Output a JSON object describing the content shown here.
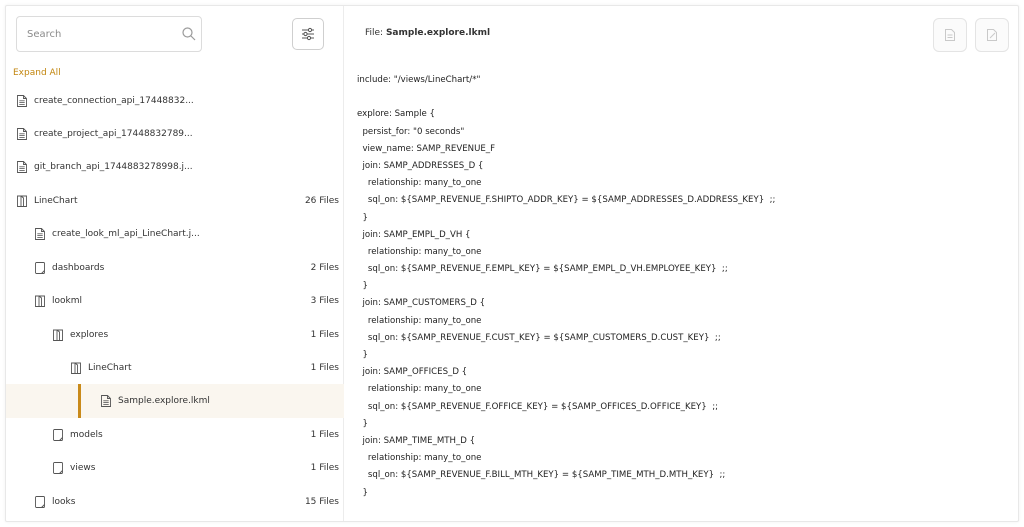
{
  "sidebar": {
    "search_placeholder": "Search",
    "expand_all": "Expand All",
    "items": [
      {
        "label": "create_connection_api_17448832...",
        "count": "",
        "type": "file",
        "depth": 0
      },
      {
        "label": "create_project_api_17448832789...",
        "count": "",
        "type": "file",
        "depth": 0
      },
      {
        "label": "git_branch_api_1744883278998.j...",
        "count": "",
        "type": "file",
        "depth": 0
      },
      {
        "label": "LineChart",
        "count": "26 Files",
        "type": "folder",
        "depth": 0
      },
      {
        "label": "create_look_ml_api_LineChart.j...",
        "count": "",
        "type": "file",
        "depth": 1
      },
      {
        "label": "dashboards",
        "count": "2 Files",
        "type": "folder-empty",
        "depth": 1
      },
      {
        "label": "lookml",
        "count": "3 Files",
        "type": "folder",
        "depth": 1
      },
      {
        "label": "explores",
        "count": "1 Files",
        "type": "folder",
        "depth": 2
      },
      {
        "label": "LineChart",
        "count": "1 Files",
        "type": "folder",
        "depth": 3
      },
      {
        "label": "Sample.explore.lkml",
        "count": "",
        "type": "file",
        "depth": 4,
        "selected": true
      },
      {
        "label": "models",
        "count": "1 Files",
        "type": "folder-empty",
        "depth": 2
      },
      {
        "label": "views",
        "count": "1 Files",
        "type": "folder-empty",
        "depth": 2
      },
      {
        "label": "looks",
        "count": "15 Files",
        "type": "folder-empty",
        "depth": 1
      }
    ]
  },
  "header": {
    "file_prefix": "File: ",
    "file_name": "Sample.explore.lkml"
  },
  "code_lines": [
    "include: \"/views/LineChart/*\"",
    "",
    "explore: Sample {",
    "  persist_for: \"0 seconds\"",
    "  view_name: SAMP_REVENUE_F",
    "  join: SAMP_ADDRESSES_D {",
    "    relationship: many_to_one",
    "    sql_on: ${SAMP_REVENUE_F.SHIPTO_ADDR_KEY} = ${SAMP_ADDRESSES_D.ADDRESS_KEY}  ;;",
    "  }",
    "  join: SAMP_EMPL_D_VH {",
    "    relationship: many_to_one",
    "    sql_on: ${SAMP_REVENUE_F.EMPL_KEY} = ${SAMP_EMPL_D_VH.EMPLOYEE_KEY}  ;;",
    "  }",
    "  join: SAMP_CUSTOMERS_D {",
    "    relationship: many_to_one",
    "    sql_on: ${SAMP_REVENUE_F.CUST_KEY} = ${SAMP_CUSTOMERS_D.CUST_KEY}  ;;",
    "  }",
    "  join: SAMP_OFFICES_D {",
    "    relationship: many_to_one",
    "    sql_on: ${SAMP_REVENUE_F.OFFICE_KEY} = ${SAMP_OFFICES_D.OFFICE_KEY}  ;;",
    "  }",
    "  join: SAMP_TIME_MTH_D {",
    "    relationship: many_to_one",
    "    sql_on: ${SAMP_REVENUE_F.BILL_MTH_KEY} = ${SAMP_TIME_MTH_D.MTH_KEY}  ;;",
    "  }"
  ],
  "colors": {
    "accent": "#c98a1a",
    "expand_link": "#c2860f"
  },
  "icons": {
    "search": "search-icon",
    "filter": "filter-sliders-icon",
    "file": "file-icon",
    "folder": "folder-icon",
    "copy": "copy-icon",
    "edit": "edit-file-icon"
  }
}
